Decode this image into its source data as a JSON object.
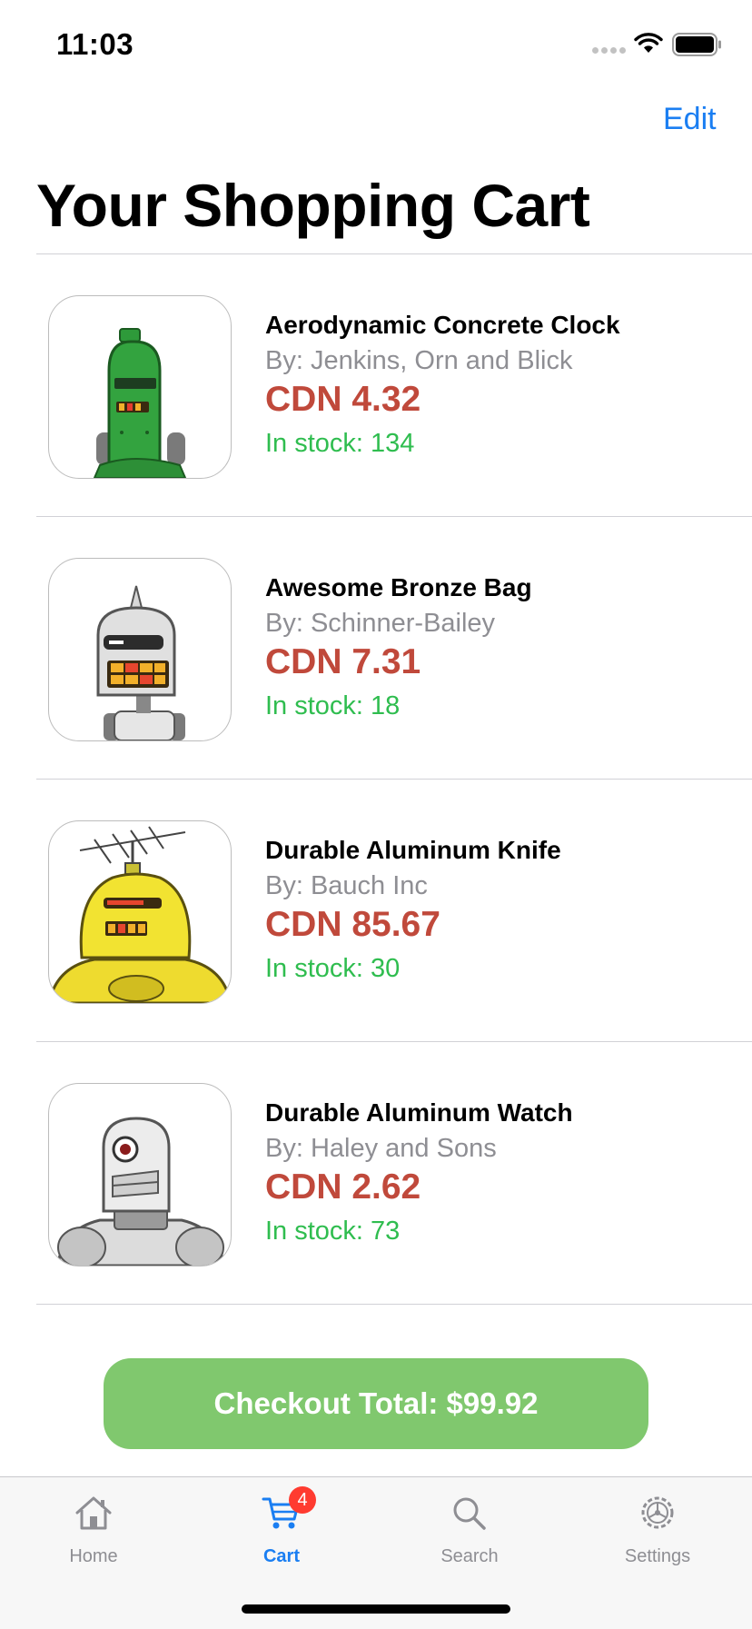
{
  "status_bar": {
    "time": "11:03"
  },
  "nav": {
    "edit_label": "Edit",
    "title": "Your Shopping Cart"
  },
  "cart": {
    "items": [
      {
        "name": "Aerodynamic Concrete Clock",
        "vendor": "By: Jenkins, Orn and Blick",
        "price": "CDN 4.32",
        "stock": "In stock: 134",
        "image": "green-robot"
      },
      {
        "name": "Awesome Bronze Bag",
        "vendor": "By: Schinner-Bailey",
        "price": "CDN 7.31",
        "stock": "In stock: 18",
        "image": "silver-spike-robot"
      },
      {
        "name": "Durable Aluminum Knife",
        "vendor": "By: Bauch Inc",
        "price": "CDN 85.67",
        "stock": "In stock: 30",
        "image": "yellow-antenna-robot"
      },
      {
        "name": "Durable Aluminum Watch",
        "vendor": "By: Haley and Sons",
        "price": "CDN 2.62",
        "stock": "In stock: 73",
        "image": "grey-cyclops-robot"
      }
    ]
  },
  "checkout": {
    "label": "Checkout Total: $99.92"
  },
  "tabs": [
    {
      "label": "Home",
      "icon": "home-icon"
    },
    {
      "label": "Cart",
      "icon": "cart-icon",
      "badge": "4",
      "active": true
    },
    {
      "label": "Search",
      "icon": "search-icon"
    },
    {
      "label": "Settings",
      "icon": "settings-icon"
    }
  ],
  "colors": {
    "accent": "#1a7ef2",
    "price": "#c0493b",
    "stock": "#2fbd4f",
    "checkout": "#80c86e",
    "badge": "#ff3b30"
  }
}
